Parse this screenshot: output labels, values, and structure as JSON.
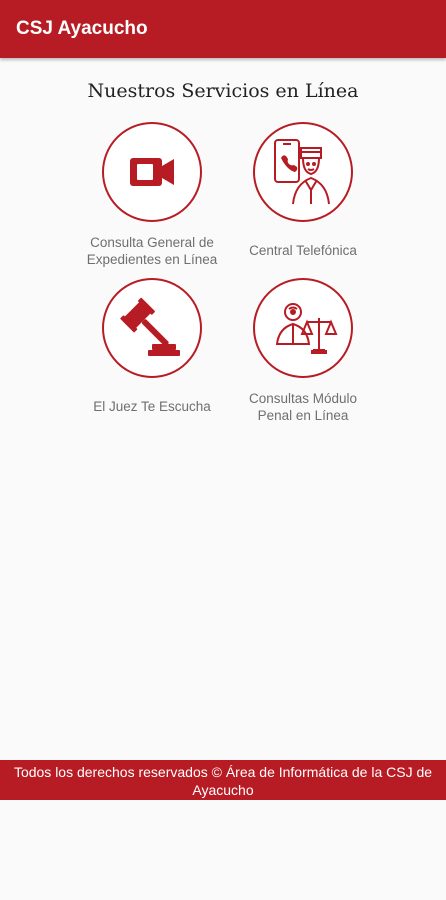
{
  "appbar": {
    "title": "CSJ Ayacucho"
  },
  "main": {
    "heading": "Nuestros Servicios en Línea",
    "services": [
      {
        "label": "Consulta General de\nExpedientes en Línea",
        "icon": "video-camera-icon"
      },
      {
        "label": "Central Telefónica",
        "icon": "phone-operator-icon"
      },
      {
        "label": "El Juez Te Escucha",
        "icon": "gavel-icon"
      },
      {
        "label": "Consultas Módulo\nPenal en Línea",
        "icon": "judge-scales-icon"
      }
    ]
  },
  "footer": {
    "text": "Todos los derechos reservados © Área de Informática de la CSJ de Ayacucho"
  },
  "colors": {
    "accent": "#b71c24",
    "background": "#fafafa",
    "label": "#6f6f6f"
  }
}
